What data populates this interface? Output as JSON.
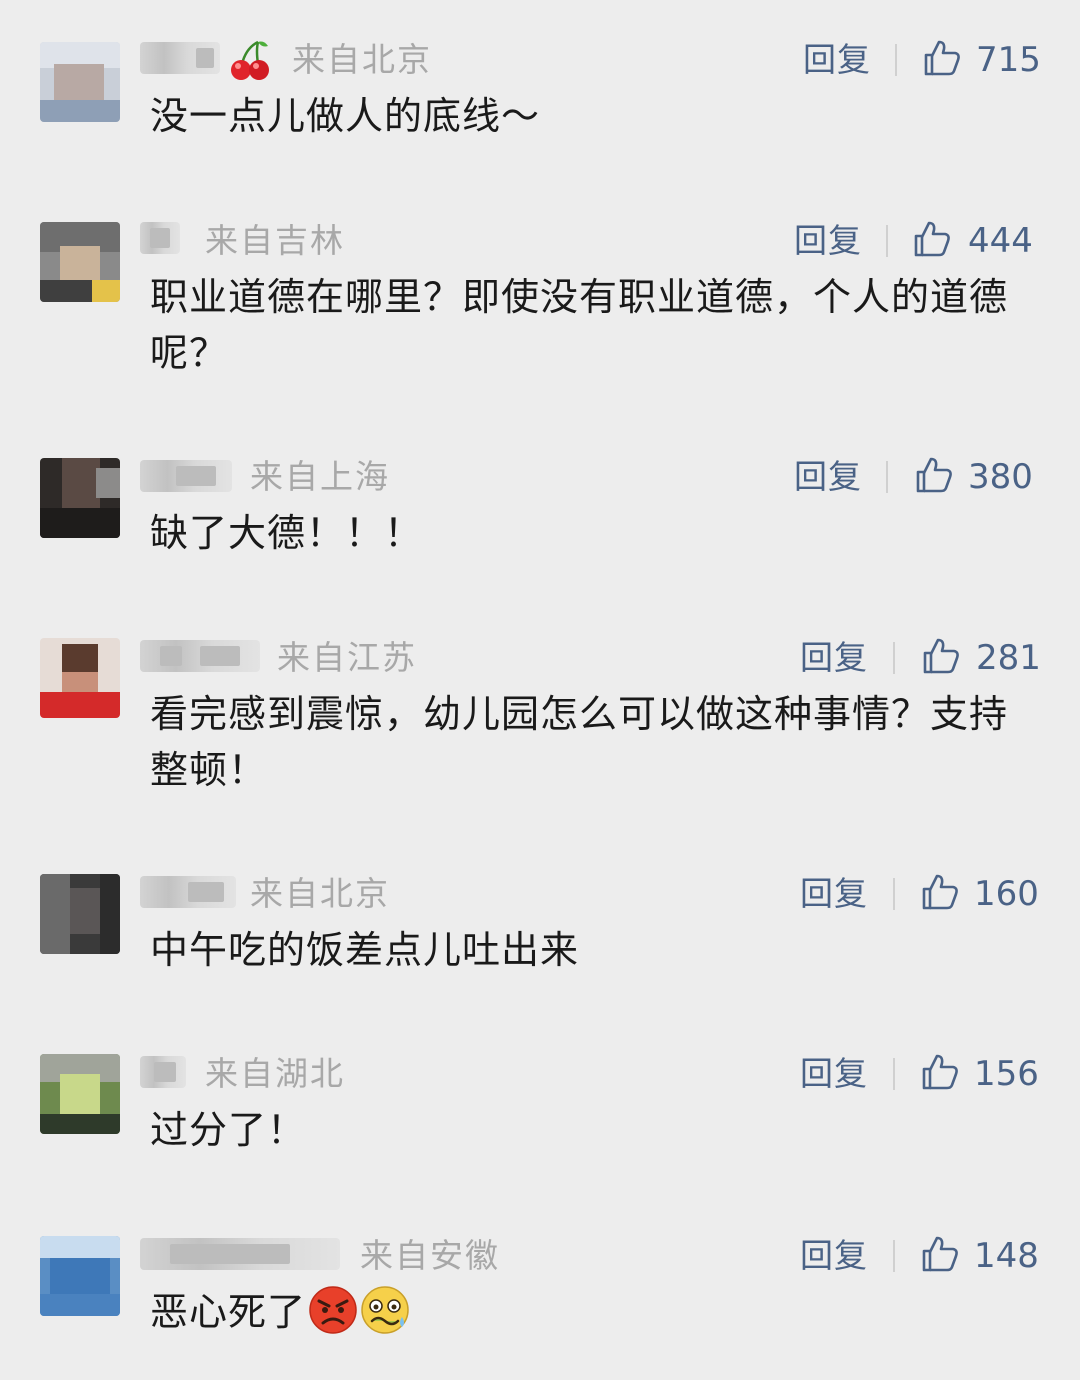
{
  "reply_label": "回复",
  "comments": [
    {
      "location": "来自北京",
      "likes": "715",
      "text": "没一点儿做人的底线～"
    },
    {
      "location": "来自吉林",
      "likes": "444",
      "text": "职业道德在哪里？即使没有职业道德，个人的道德呢？"
    },
    {
      "location": "来自上海",
      "likes": "380",
      "text": "缺了大德！！！"
    },
    {
      "location": "来自江苏",
      "likes": "281",
      "text": "看完感到震惊，幼儿园怎么可以做这种事情？支持整顿！"
    },
    {
      "location": "来自北京",
      "likes": "160",
      "text": "中午吃的饭差点儿吐出来"
    },
    {
      "location": "来自湖北",
      "likes": "156",
      "text": "过分了！"
    },
    {
      "location": "来自安徽",
      "likes": "148",
      "text": "恶心死了"
    }
  ],
  "icons": {
    "like": "thumbs-up-icon",
    "cherry": "cherry-icon",
    "angry": "angry-face-emoji",
    "nauseated": "nauseated-face-emoji"
  },
  "colors": {
    "background": "#ededed",
    "link": "#4a6286",
    "location": "#a8a8a8",
    "text": "#1a1a1a"
  }
}
